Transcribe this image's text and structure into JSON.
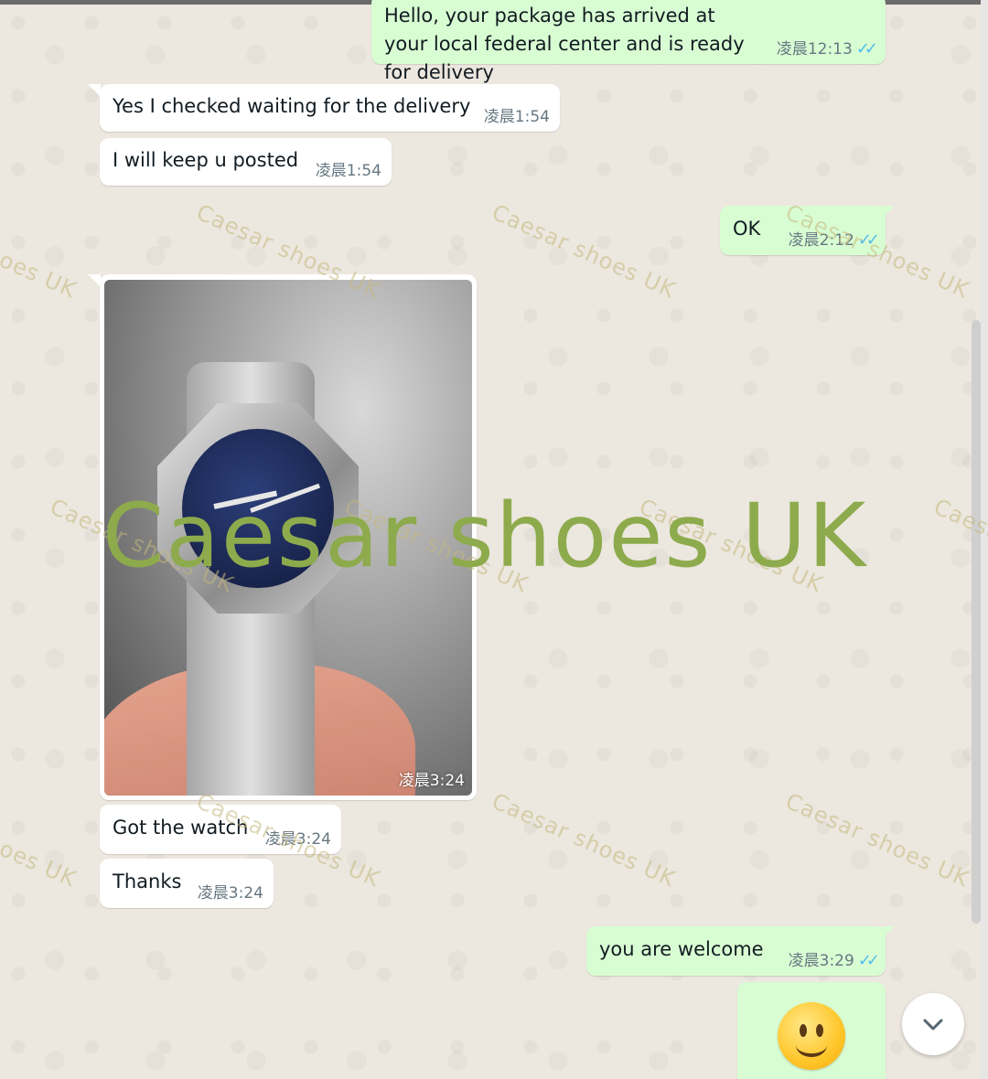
{
  "messages": [
    {
      "id": "m1",
      "dir": "out",
      "text": "Hello, your package has arrived at your local federal center and is ready for delivery",
      "time": "凌晨12:13",
      "read": true
    },
    {
      "id": "m2",
      "dir": "in",
      "text": "Yes I checked waiting for the delivery",
      "time": "凌晨1:54"
    },
    {
      "id": "m3",
      "dir": "in",
      "text": "I will keep u posted",
      "time": "凌晨1:54"
    },
    {
      "id": "m4",
      "dir": "out",
      "text": "OK",
      "time": "凌晨2:12",
      "read": true
    },
    {
      "id": "m5",
      "dir": "in",
      "type": "image",
      "time": "凌晨3:24"
    },
    {
      "id": "m6",
      "dir": "in",
      "text": "Got the watch",
      "time": "凌晨3:24"
    },
    {
      "id": "m7",
      "dir": "in",
      "text": "Thanks",
      "time": "凌晨3:24"
    },
    {
      "id": "m8",
      "dir": "out",
      "text": "you are welcome",
      "time": "凌晨3:29",
      "read": true
    },
    {
      "id": "m9",
      "dir": "out",
      "type": "emoji",
      "emoji": "slightly-smiling-face"
    }
  ],
  "watermark": {
    "text": "Caesar shoes UK",
    "big_text": "Caesar  shoes  UK"
  },
  "scroll_button": {
    "icon": "chevron-down-icon"
  },
  "colors": {
    "incoming": "#ffffff",
    "outgoing": "#d9fdd3",
    "read_ticks": "#53bdeb",
    "watermark_big": "#8dab4c",
    "chat_bg": "#ece7df"
  }
}
